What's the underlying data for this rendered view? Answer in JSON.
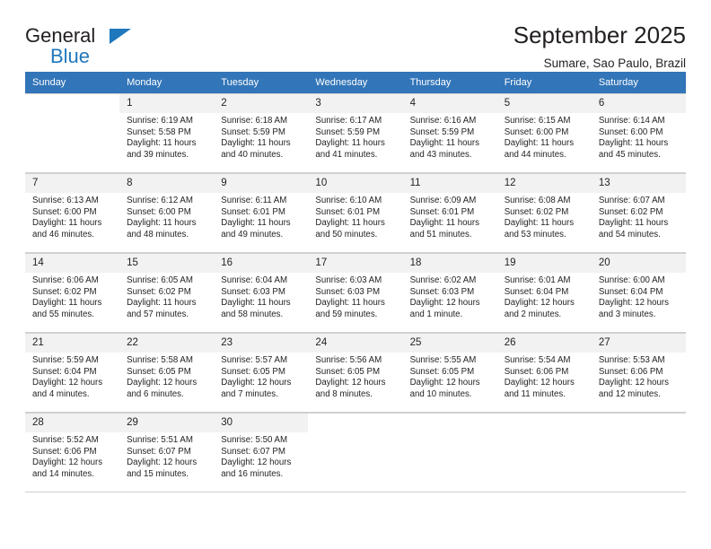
{
  "brand": {
    "line1": "General",
    "line2": "Blue",
    "mark": "triangle-logo-mark"
  },
  "header": {
    "title": "September 2025",
    "location": "Sumare, Sao Paulo, Brazil"
  },
  "colors": {
    "header_blue": "#3275b8",
    "brand_blue": "#1f77bc",
    "daynum_bg": "#f2f2f2",
    "cell_border": "#d0d0d0",
    "text": "#231f20"
  },
  "calendar": {
    "weekday_headers": [
      "Sunday",
      "Monday",
      "Tuesday",
      "Wednesday",
      "Thursday",
      "Friday",
      "Saturday"
    ],
    "labels": {
      "sunrise": "Sunrise:",
      "sunset": "Sunset:",
      "daylight": "Daylight:"
    },
    "weeks": [
      [
        {
          "day": "",
          "sunrise": "",
          "sunset": "",
          "daylight": "",
          "empty": true
        },
        {
          "day": "1",
          "sunrise": "Sunrise: 6:19 AM",
          "sunset": "Sunset: 5:58 PM",
          "daylight": "Daylight: 11 hours and 39 minutes."
        },
        {
          "day": "2",
          "sunrise": "Sunrise: 6:18 AM",
          "sunset": "Sunset: 5:59 PM",
          "daylight": "Daylight: 11 hours and 40 minutes."
        },
        {
          "day": "3",
          "sunrise": "Sunrise: 6:17 AM",
          "sunset": "Sunset: 5:59 PM",
          "daylight": "Daylight: 11 hours and 41 minutes."
        },
        {
          "day": "4",
          "sunrise": "Sunrise: 6:16 AM",
          "sunset": "Sunset: 5:59 PM",
          "daylight": "Daylight: 11 hours and 43 minutes."
        },
        {
          "day": "5",
          "sunrise": "Sunrise: 6:15 AM",
          "sunset": "Sunset: 6:00 PM",
          "daylight": "Daylight: 11 hours and 44 minutes."
        },
        {
          "day": "6",
          "sunrise": "Sunrise: 6:14 AM",
          "sunset": "Sunset: 6:00 PM",
          "daylight": "Daylight: 11 hours and 45 minutes."
        }
      ],
      [
        {
          "day": "7",
          "sunrise": "Sunrise: 6:13 AM",
          "sunset": "Sunset: 6:00 PM",
          "daylight": "Daylight: 11 hours and 46 minutes."
        },
        {
          "day": "8",
          "sunrise": "Sunrise: 6:12 AM",
          "sunset": "Sunset: 6:00 PM",
          "daylight": "Daylight: 11 hours and 48 minutes."
        },
        {
          "day": "9",
          "sunrise": "Sunrise: 6:11 AM",
          "sunset": "Sunset: 6:01 PM",
          "daylight": "Daylight: 11 hours and 49 minutes."
        },
        {
          "day": "10",
          "sunrise": "Sunrise: 6:10 AM",
          "sunset": "Sunset: 6:01 PM",
          "daylight": "Daylight: 11 hours and 50 minutes."
        },
        {
          "day": "11",
          "sunrise": "Sunrise: 6:09 AM",
          "sunset": "Sunset: 6:01 PM",
          "daylight": "Daylight: 11 hours and 51 minutes."
        },
        {
          "day": "12",
          "sunrise": "Sunrise: 6:08 AM",
          "sunset": "Sunset: 6:02 PM",
          "daylight": "Daylight: 11 hours and 53 minutes."
        },
        {
          "day": "13",
          "sunrise": "Sunrise: 6:07 AM",
          "sunset": "Sunset: 6:02 PM",
          "daylight": "Daylight: 11 hours and 54 minutes."
        }
      ],
      [
        {
          "day": "14",
          "sunrise": "Sunrise: 6:06 AM",
          "sunset": "Sunset: 6:02 PM",
          "daylight": "Daylight: 11 hours and 55 minutes."
        },
        {
          "day": "15",
          "sunrise": "Sunrise: 6:05 AM",
          "sunset": "Sunset: 6:02 PM",
          "daylight": "Daylight: 11 hours and 57 minutes."
        },
        {
          "day": "16",
          "sunrise": "Sunrise: 6:04 AM",
          "sunset": "Sunset: 6:03 PM",
          "daylight": "Daylight: 11 hours and 58 minutes."
        },
        {
          "day": "17",
          "sunrise": "Sunrise: 6:03 AM",
          "sunset": "Sunset: 6:03 PM",
          "daylight": "Daylight: 11 hours and 59 minutes."
        },
        {
          "day": "18",
          "sunrise": "Sunrise: 6:02 AM",
          "sunset": "Sunset: 6:03 PM",
          "daylight": "Daylight: 12 hours and 1 minute."
        },
        {
          "day": "19",
          "sunrise": "Sunrise: 6:01 AM",
          "sunset": "Sunset: 6:04 PM",
          "daylight": "Daylight: 12 hours and 2 minutes."
        },
        {
          "day": "20",
          "sunrise": "Sunrise: 6:00 AM",
          "sunset": "Sunset: 6:04 PM",
          "daylight": "Daylight: 12 hours and 3 minutes."
        }
      ],
      [
        {
          "day": "21",
          "sunrise": "Sunrise: 5:59 AM",
          "sunset": "Sunset: 6:04 PM",
          "daylight": "Daylight: 12 hours and 4 minutes."
        },
        {
          "day": "22",
          "sunrise": "Sunrise: 5:58 AM",
          "sunset": "Sunset: 6:05 PM",
          "daylight": "Daylight: 12 hours and 6 minutes."
        },
        {
          "day": "23",
          "sunrise": "Sunrise: 5:57 AM",
          "sunset": "Sunset: 6:05 PM",
          "daylight": "Daylight: 12 hours and 7 minutes."
        },
        {
          "day": "24",
          "sunrise": "Sunrise: 5:56 AM",
          "sunset": "Sunset: 6:05 PM",
          "daylight": "Daylight: 12 hours and 8 minutes."
        },
        {
          "day": "25",
          "sunrise": "Sunrise: 5:55 AM",
          "sunset": "Sunset: 6:05 PM",
          "daylight": "Daylight: 12 hours and 10 minutes."
        },
        {
          "day": "26",
          "sunrise": "Sunrise: 5:54 AM",
          "sunset": "Sunset: 6:06 PM",
          "daylight": "Daylight: 12 hours and 11 minutes."
        },
        {
          "day": "27",
          "sunrise": "Sunrise: 5:53 AM",
          "sunset": "Sunset: 6:06 PM",
          "daylight": "Daylight: 12 hours and 12 minutes."
        }
      ],
      [
        {
          "day": "28",
          "sunrise": "Sunrise: 5:52 AM",
          "sunset": "Sunset: 6:06 PM",
          "daylight": "Daylight: 12 hours and 14 minutes."
        },
        {
          "day": "29",
          "sunrise": "Sunrise: 5:51 AM",
          "sunset": "Sunset: 6:07 PM",
          "daylight": "Daylight: 12 hours and 15 minutes."
        },
        {
          "day": "30",
          "sunrise": "Sunrise: 5:50 AM",
          "sunset": "Sunset: 6:07 PM",
          "daylight": "Daylight: 12 hours and 16 minutes."
        },
        {
          "day": "",
          "sunrise": "",
          "sunset": "",
          "daylight": "",
          "empty": true
        },
        {
          "day": "",
          "sunrise": "",
          "sunset": "",
          "daylight": "",
          "empty": true
        },
        {
          "day": "",
          "sunrise": "",
          "sunset": "",
          "daylight": "",
          "empty": true
        },
        {
          "day": "",
          "sunrise": "",
          "sunset": "",
          "daylight": "",
          "empty": true
        }
      ]
    ]
  }
}
